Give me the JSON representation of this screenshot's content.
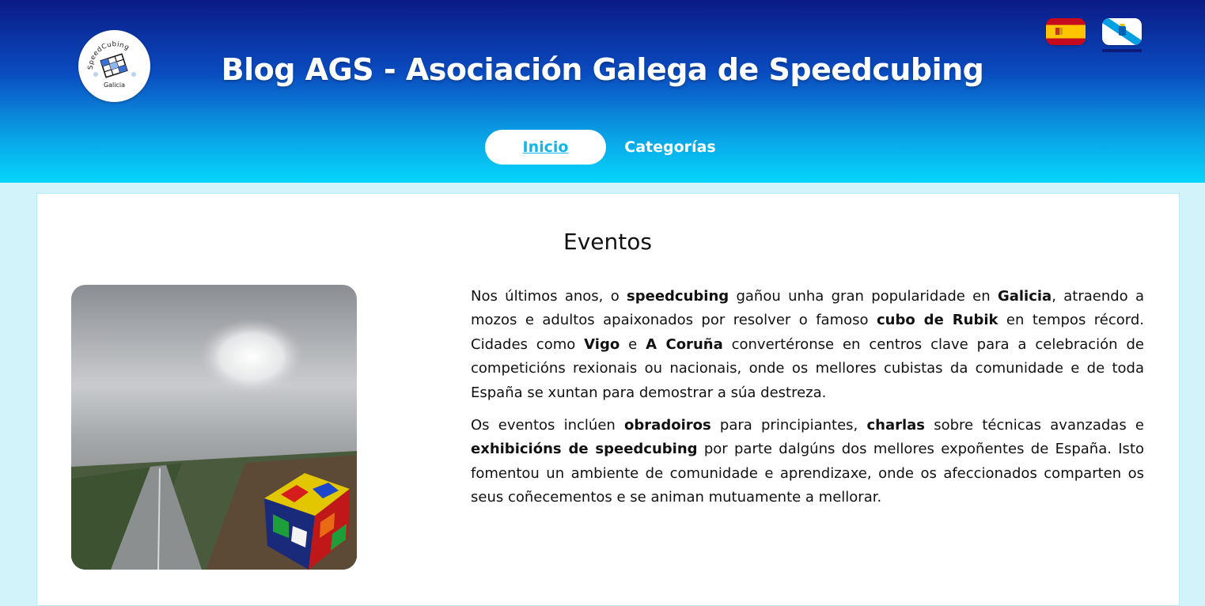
{
  "header": {
    "title": "Blog AGS - Asociación Galega de Speedcubing",
    "logo_icon": "speedcubing-galicia-logo-icon",
    "logo_text_top": "SpeedCubing",
    "logo_text_bottom": "Galicia",
    "languages": [
      {
        "name": "spanish-flag-icon",
        "code": "es",
        "active": false
      },
      {
        "name": "galician-flag-icon",
        "code": "gl",
        "active": true
      }
    ]
  },
  "nav": {
    "items": [
      {
        "label": "Inicio",
        "active": true
      },
      {
        "label": "Categorías",
        "active": false
      }
    ]
  },
  "main": {
    "section_title": "Eventos",
    "image_icon": "rubik-cube-rainy-window-photo",
    "p1": {
      "s1": "Nos últimos anos, o ",
      "b1": "speedcubing",
      "s2": " gañou unha gran popularidade en ",
      "b2": "Galicia",
      "s3": ", atraendo a mozos e adultos apaixonados por resolver o famoso ",
      "b3": "cubo de Rubik",
      "s4": " en tempos récord. Cidades como ",
      "b4": "Vigo",
      "s5": " e ",
      "b5": "A Coruña",
      "s6": " convertéronse en centros clave para a celebración de competicións rexionais ou nacionais, onde os mellores cubistas da comunidade e de toda España se xuntan para demostrar a súa destreza."
    },
    "p2": {
      "s1": "Os eventos inclúen ",
      "b1": "obradoiros",
      "s2": " para principiantes, ",
      "b2": "charlas",
      "s3": " sobre técnicas avanzadas e ",
      "b3": "exhibicións de speedcubing",
      "s4": " por parte dalgúns dos mellores expoñentes de España. Isto fomentou un ambiente de comunidade e aprendizaxe, onde os afeccionados comparten os seus coñecementos e se animan mutuamente a mellorar."
    }
  },
  "colors": {
    "header_top": "#0b1a86",
    "header_bottom": "#05d6fb",
    "page_bg": "#d3f3fb",
    "nav_active_text": "#10b6e8",
    "text": "#111111"
  }
}
